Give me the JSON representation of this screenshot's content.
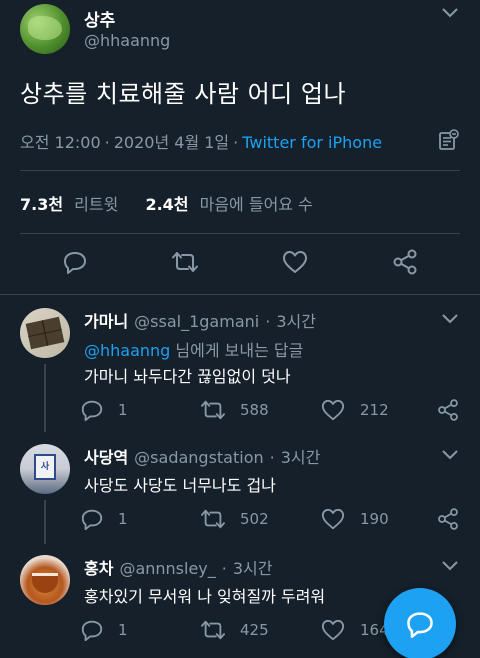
{
  "main_tweet": {
    "author_name": "상추",
    "author_handle": "@hhaanng",
    "text": "상추를 치료해줄 사람 어디 업나",
    "time": "오전 12:00",
    "date": "2020년 4월 1일",
    "source": "Twitter for iPhone",
    "retweets_count": "7.3천",
    "retweets_label": "리트윗",
    "likes_count": "2.4천",
    "likes_label": "마음에 들어요 수"
  },
  "replies": [
    {
      "name": "가마니",
      "handle": "@ssal_1gamani",
      "time": "3시간",
      "replying_to_handle": "@hhaanng",
      "replying_to_suffix": " 님에게 보내는 답글",
      "text": "가마니 놔두다간 끊임없이 덧나",
      "reply_count": "1",
      "retweet_count": "588",
      "like_count": "212"
    },
    {
      "name": "사당역",
      "handle": "@sadangstation",
      "time": "3시간",
      "text": "사당도 사당도 너무나도 겁나",
      "reply_count": "1",
      "retweet_count": "502",
      "like_count": "190"
    },
    {
      "name": "홍차",
      "handle": "@annnsley_",
      "time": "3시간",
      "text": "홍차있기 무서워 나 잊혀질까 두려워",
      "reply_count": "1",
      "retweet_count": "425",
      "like_count": "164"
    }
  ],
  "separator": "·",
  "avatar2_sign_text": "사"
}
